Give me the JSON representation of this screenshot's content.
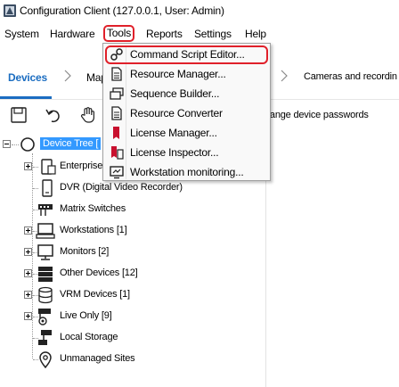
{
  "window": {
    "title": "Configuration Client (127.0.0.1, User: Admin)"
  },
  "menubar": {
    "items": [
      "System",
      "Hardware",
      "Tools",
      "Reports",
      "Settings",
      "Help"
    ]
  },
  "nav": {
    "devices": "Devices",
    "maps": "Map",
    "cameras": "Cameras and recordin"
  },
  "toolbar": {
    "change_passwords": "hange device passwords"
  },
  "tools_menu": {
    "items": [
      {
        "label": "Command Script Editor...",
        "icon": "script-icon"
      },
      {
        "label": "Resource Manager...",
        "icon": "document-icon"
      },
      {
        "label": "Sequence Builder...",
        "icon": "sequence-icon"
      },
      {
        "label": "Resource Converter",
        "icon": "document-icon"
      },
      {
        "label": "License Manager...",
        "icon": "license-icon"
      },
      {
        "label": "License Inspector...",
        "icon": "license-inspector-icon"
      },
      {
        "label": "Workstation monitoring...",
        "icon": "monitor-icon"
      }
    ]
  },
  "tree": {
    "root": "Device Tree [",
    "items": [
      {
        "label": "Enterprise"
      },
      {
        "label": "DVR (Digital Video Recorder)"
      },
      {
        "label": "Matrix Switches"
      },
      {
        "label": "Workstations [1]"
      },
      {
        "label": "Monitors [2]"
      },
      {
        "label": "Other Devices [12]"
      },
      {
        "label": "VRM Devices [1]"
      },
      {
        "label": "Live Only [9]"
      },
      {
        "label": "Local Storage"
      },
      {
        "label": "Unmanaged Sites"
      }
    ]
  },
  "colors": {
    "accent": "#1b6dc1",
    "highlight_border": "#e0202a",
    "selection": "#3399ff"
  }
}
